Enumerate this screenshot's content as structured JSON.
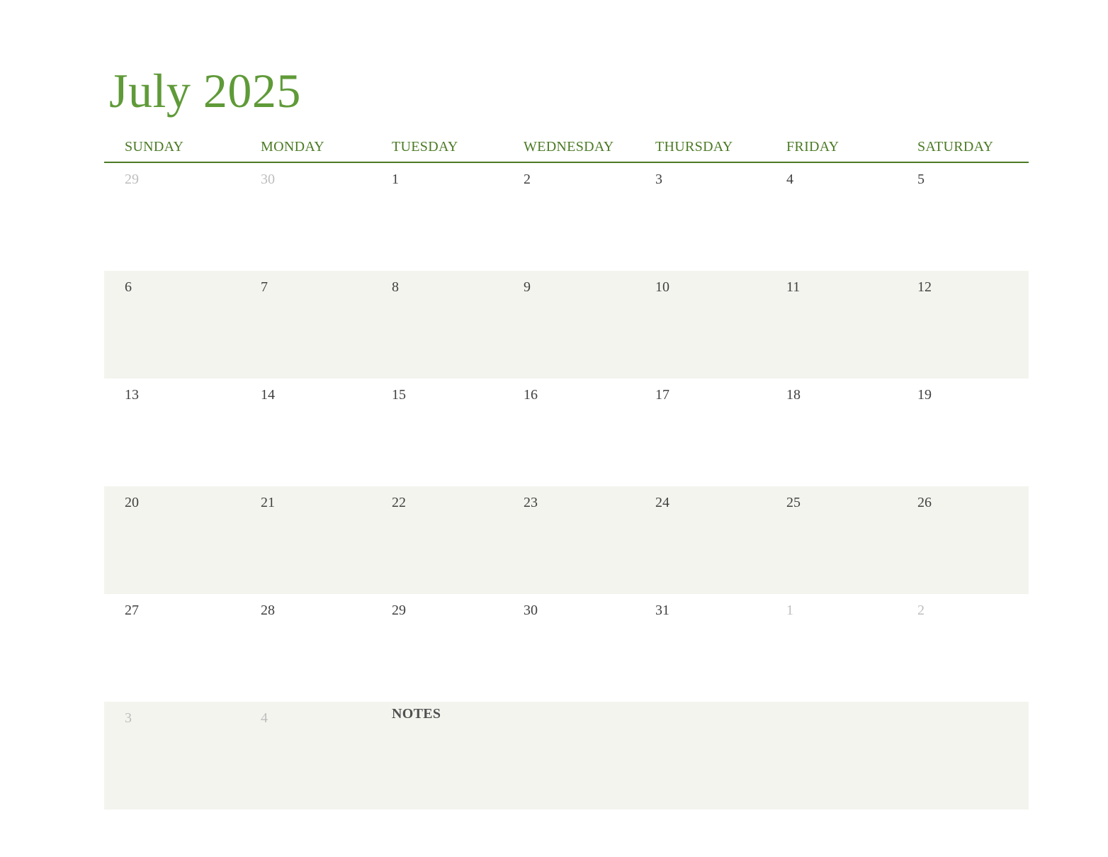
{
  "title": "July 2025",
  "colors": {
    "accent": "#5f9a38",
    "header_text": "#4b7a24",
    "shade": "#f4f4ef",
    "date_text": "#404040",
    "other_month_text": "#bdbdbd"
  },
  "weekdays": [
    "SUNDAY",
    "MONDAY",
    "TUESDAY",
    "WEDNESDAY",
    "THURSDAY",
    "FRIDAY",
    "SATURDAY"
  ],
  "weeks": [
    [
      {
        "d": "29",
        "other": true
      },
      {
        "d": "30",
        "other": true
      },
      {
        "d": "1"
      },
      {
        "d": "2"
      },
      {
        "d": "3"
      },
      {
        "d": "4"
      },
      {
        "d": "5"
      }
    ],
    [
      {
        "d": "6"
      },
      {
        "d": "7"
      },
      {
        "d": "8"
      },
      {
        "d": "9"
      },
      {
        "d": "10"
      },
      {
        "d": "11"
      },
      {
        "d": "12"
      }
    ],
    [
      {
        "d": "13"
      },
      {
        "d": "14"
      },
      {
        "d": "15"
      },
      {
        "d": "16"
      },
      {
        "d": "17"
      },
      {
        "d": "18"
      },
      {
        "d": "19"
      }
    ],
    [
      {
        "d": "20"
      },
      {
        "d": "21"
      },
      {
        "d": "22"
      },
      {
        "d": "23"
      },
      {
        "d": "24"
      },
      {
        "d": "25"
      },
      {
        "d": "26"
      }
    ],
    [
      {
        "d": "27"
      },
      {
        "d": "28"
      },
      {
        "d": "29"
      },
      {
        "d": "30"
      },
      {
        "d": "31"
      },
      {
        "d": "1",
        "other": true
      },
      {
        "d": "2",
        "other": true
      }
    ]
  ],
  "last_row": {
    "dates": [
      {
        "d": "3",
        "other": true
      },
      {
        "d": "4",
        "other": true
      }
    ],
    "notes_label": "NOTES"
  }
}
